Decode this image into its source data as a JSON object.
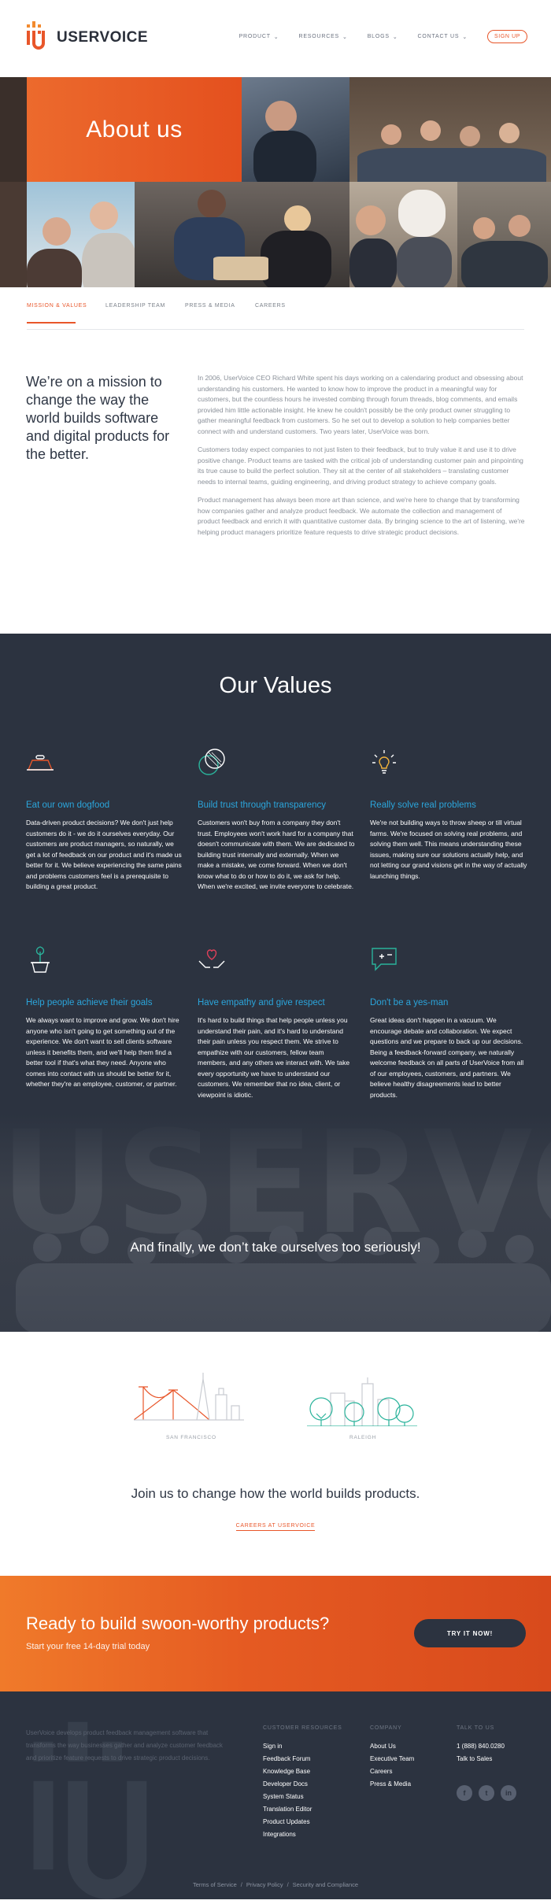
{
  "header": {
    "brand": "USERVOICE",
    "nav": [
      {
        "label": "PRODUCT",
        "has_chevron": true
      },
      {
        "label": "RESOURCES",
        "has_chevron": true
      },
      {
        "label": "BLOGS",
        "has_chevron": true
      },
      {
        "label": "CONTACT US",
        "has_chevron": true
      }
    ],
    "signup_label": "SIGN UP"
  },
  "hero": {
    "title": "About us"
  },
  "tabs": [
    {
      "label": "MISSION & VALUES",
      "active": true
    },
    {
      "label": "LEADERSHIP TEAM",
      "active": false
    },
    {
      "label": "PRESS & MEDIA",
      "active": false
    },
    {
      "label": "CAREERS",
      "active": false
    }
  ],
  "mission": {
    "headline": "We’re on a mission to change the way the world builds software and digital products for the better.",
    "paragraphs": [
      "In 2006, UserVoice CEO Richard White spent his days working on a calendaring product and obsessing about understanding his customers. He wanted to know how to improve the product in a meaningful way for customers, but the countless hours he invested combing through forum threads, blog comments, and emails provided him little actionable insight. He knew he couldn't possibly be the only product owner struggling to gather meaningful feedback from customers. So he set out to develop a solution to help companies better connect with and understand customers. Two years later, UserVoice was born.",
      "Customers today expect companies to not just listen to their feedback, but to truly value it and use it to drive positive change. Product teams are tasked with the critical job of understanding customer pain and pinpointing its true cause to build the perfect solution. They sit at the center of all stakeholders – translating customer needs to internal teams, guiding engineering, and driving product strategy to achieve company goals.",
      "Product management has always been more art than science, and we're here to change that by transforming how companies gather and analyze product feedback. We automate the collection and management of product feedback and enrich it with quantitative customer data. By bringing science to the art of listening, we're helping product managers prioritize feature requests to drive strategic product decisions."
    ]
  },
  "values": {
    "title": "Our Values",
    "items": [
      {
        "icon": "dog-bowl-icon",
        "title": "Eat our own dogfood",
        "body": "Data-driven product decisions? We don't just help customers do it - we do it ourselves everyday. Our customers are product managers, so naturally, we get a lot of feedback on our product and it's made us better for it. We believe experiencing the same pains and problems customers feel is a prerequisite to building a great product."
      },
      {
        "icon": "transparency-circles-icon",
        "title": "Build trust through transparency",
        "body": "Customers won't buy from a company they don't trust. Employees won't work hard for a company that doesn't communicate with them. We are dedicated to building trust internally and externally. When we make a mistake, we come forward. When we don't know what to do or how to do it, we ask for help. When we're excited, we invite everyone to celebrate."
      },
      {
        "icon": "lightbulb-icon",
        "title": "Really solve real problems",
        "body": "We're not building ways to throw sheep or till virtual farms. We're focused on solving real problems, and solving them well. This means understanding these issues, making sure our solutions actually help, and not letting our grand visions get in the way of actually launching things."
      },
      {
        "icon": "potted-plant-icon",
        "title": "Help people achieve their goals",
        "body": "We always want to improve and grow. We don't hire anyone who isn't going to get something out of the experience. We don't want to sell clients software unless it benefits them, and we'll help them find a better tool if that's what they need. Anyone who comes into contact with us should be better for it, whether they're an employee, customer, or partner."
      },
      {
        "icon": "heart-hands-icon",
        "title": "Have empathy and give respect",
        "body": "It's hard to build things that help people unless you understand their pain, and it's hard to understand their pain unless you respect them. We strive to empathize with our customers, fellow team members, and any others we interact with. We take every opportunity we have to understand our customers. We remember that no idea, client, or viewpoint is idiotic."
      },
      {
        "icon": "chat-plus-minus-icon",
        "title": "Don't be a yes-man",
        "body": "Great ideas don't happen in a vacuum. We encourage debate and collaboration. We expect questions and we prepare to back up our decisions. Being a feedback-forward company, we naturally welcome feedback on all parts of UserVoice from all of our employees, customers, and partners. We believe healthy disagreements lead to better products."
      }
    ],
    "finally": "And finally, we don’t take ourselves too seriously!"
  },
  "cities": {
    "sf_label": "SAN FRANCISCO",
    "raleigh_label": "RALEIGH",
    "join_text": "Join us to change how the world builds products.",
    "careers_link": "CAREERS AT USERVOICE"
  },
  "cta": {
    "title": "Ready to build swoon-worthy products?",
    "subtitle": "Start your free 14-day trial today",
    "button": "TRY IT NOW!"
  },
  "footer": {
    "about": "UserVoice develops product feedback management software that transforms the way businesses gather and analyze customer feedback and prioritize feature requests to drive strategic product decisions.",
    "columns": [
      {
        "head": "CUSTOMER RESOURCES",
        "links": [
          "Sign in",
          "Feedback Forum",
          "Knowledge Base",
          "Developer Docs",
          "System Status",
          "Translation Editor",
          "Product Updates",
          "Integrations"
        ]
      },
      {
        "head": "COMPANY",
        "links": [
          "About Us",
          "Executive Team",
          "Careers",
          "Press & Media"
        ]
      },
      {
        "head": "TALK TO US",
        "links": [
          "1 (888) 840.0280",
          "Talk to Sales"
        ]
      }
    ],
    "socials": [
      {
        "icon": "facebook-icon",
        "glyph": "f"
      },
      {
        "icon": "twitter-icon",
        "glyph": "t"
      },
      {
        "icon": "linkedin-icon",
        "glyph": "in"
      }
    ],
    "legal": [
      "Terms of Service",
      "Privacy Policy",
      "Security and Compliance"
    ]
  },
  "colors": {
    "accent": "#e8562a",
    "dark": "#2c3340",
    "value_title": "#2ba5db"
  }
}
